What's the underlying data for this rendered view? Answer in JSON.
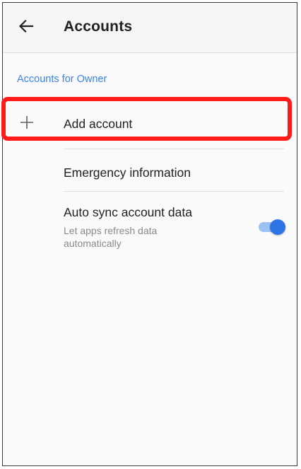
{
  "header": {
    "title": "Accounts",
    "back_icon": "arrow-left-icon"
  },
  "section": {
    "label": "Accounts for Owner"
  },
  "items": {
    "add_account": {
      "label": "Add account",
      "icon": "plus-icon"
    },
    "emergency": {
      "label": "Emergency information"
    },
    "auto_sync": {
      "title": "Auto sync account data",
      "subtitle": "Let apps refresh data automatically",
      "enabled": true
    }
  },
  "colors": {
    "accent": "#3c82e6",
    "toggle_thumb": "#2f74e4",
    "toggle_track": "#9ec1f3",
    "highlight": "#ff1a1a"
  }
}
